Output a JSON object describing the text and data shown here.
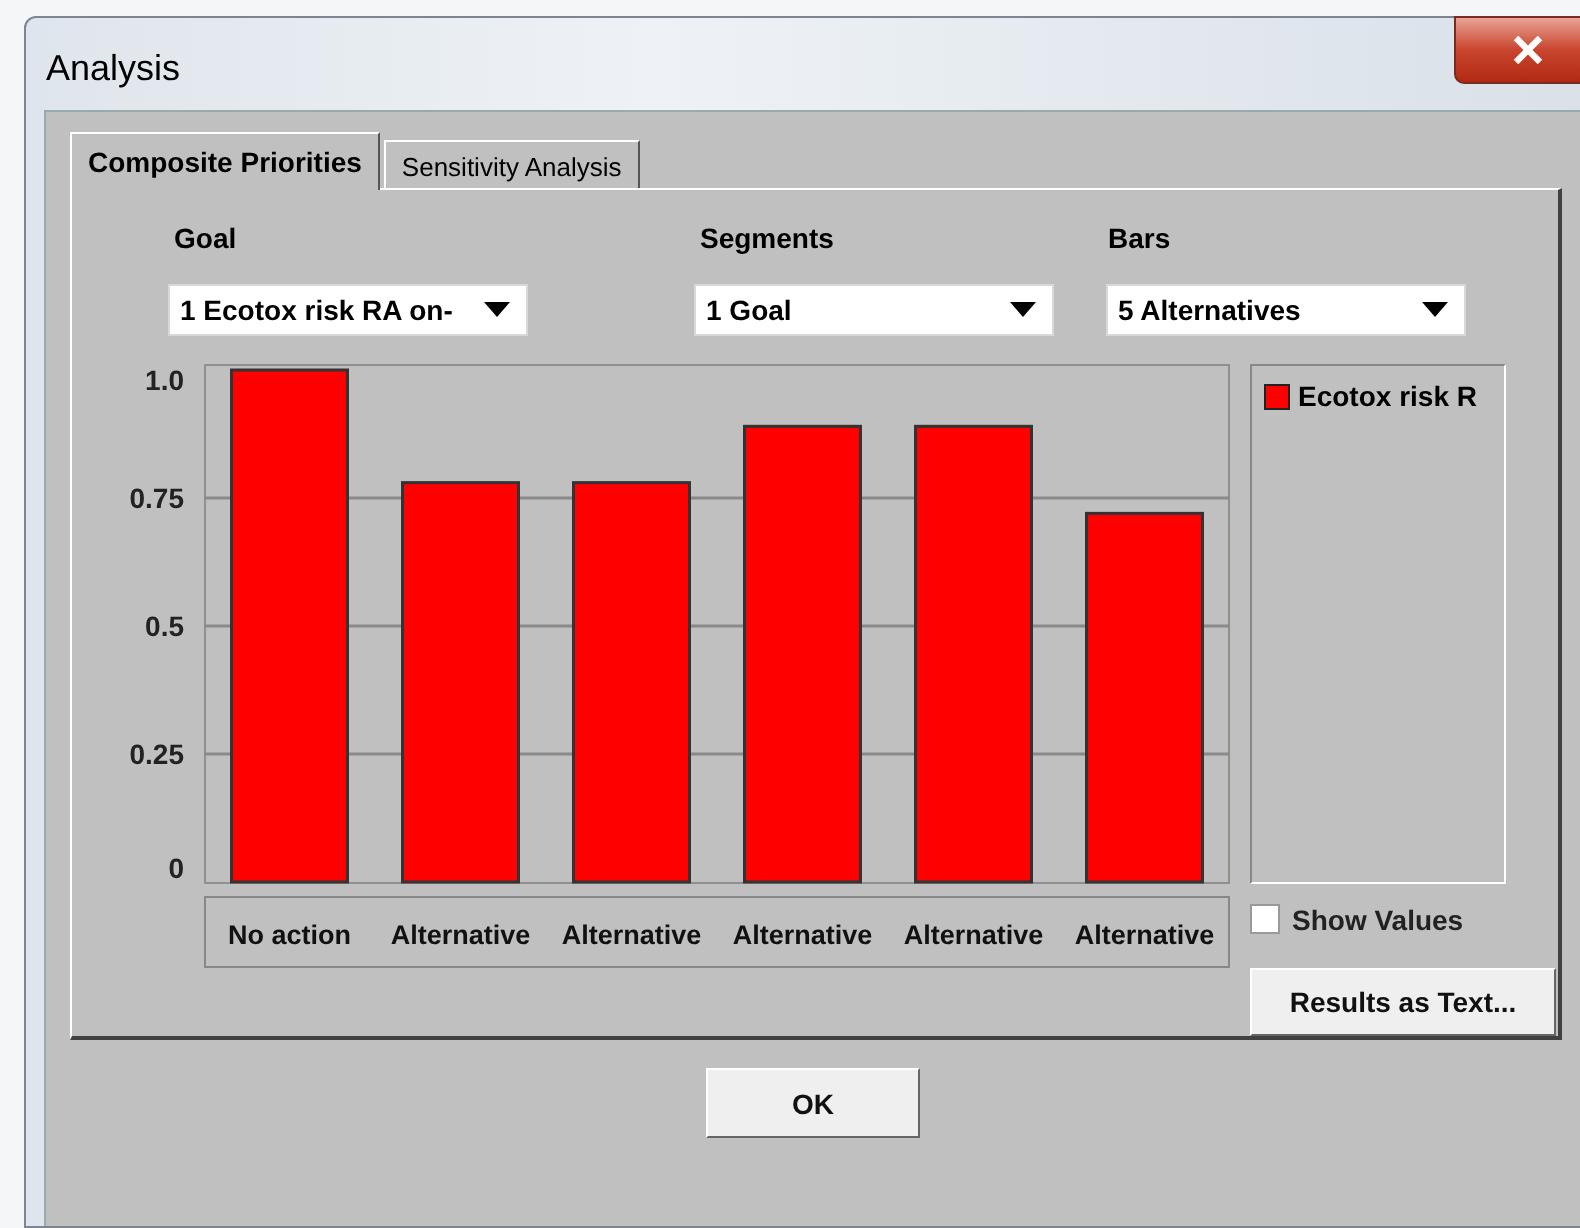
{
  "window": {
    "title": "Analysis"
  },
  "tabs": [
    {
      "label": "Composite Priorities",
      "selected": true
    },
    {
      "label": "Sensitivity Analysis",
      "selected": false
    }
  ],
  "controls": [
    {
      "label": "Goal",
      "value": "1 Ecotox risk RA on-"
    },
    {
      "label": "Segments",
      "value": "1 Goal"
    },
    {
      "label": "Bars",
      "value": "5 Alternatives"
    }
  ],
  "chart_data": {
    "type": "bar",
    "categories": [
      "No action",
      "Alternative",
      "Alternative",
      "Alternative",
      "Alternative",
      "Alternative"
    ],
    "series": [
      {
        "name": "Ecotox risk R",
        "color": "#ff0000",
        "values": [
          1.0,
          0.78,
          0.78,
          0.89,
          0.89,
          0.72
        ]
      }
    ],
    "ylim": [
      0,
      1
    ],
    "yticks": [
      0,
      0.25,
      0.5,
      0.75,
      {
        "value": 1,
        "label": "1.0"
      }
    ],
    "grid": true
  },
  "show_values": {
    "label": "Show Values",
    "checked": false
  },
  "results_button": "Results as Text...",
  "ok_button": "OK"
}
